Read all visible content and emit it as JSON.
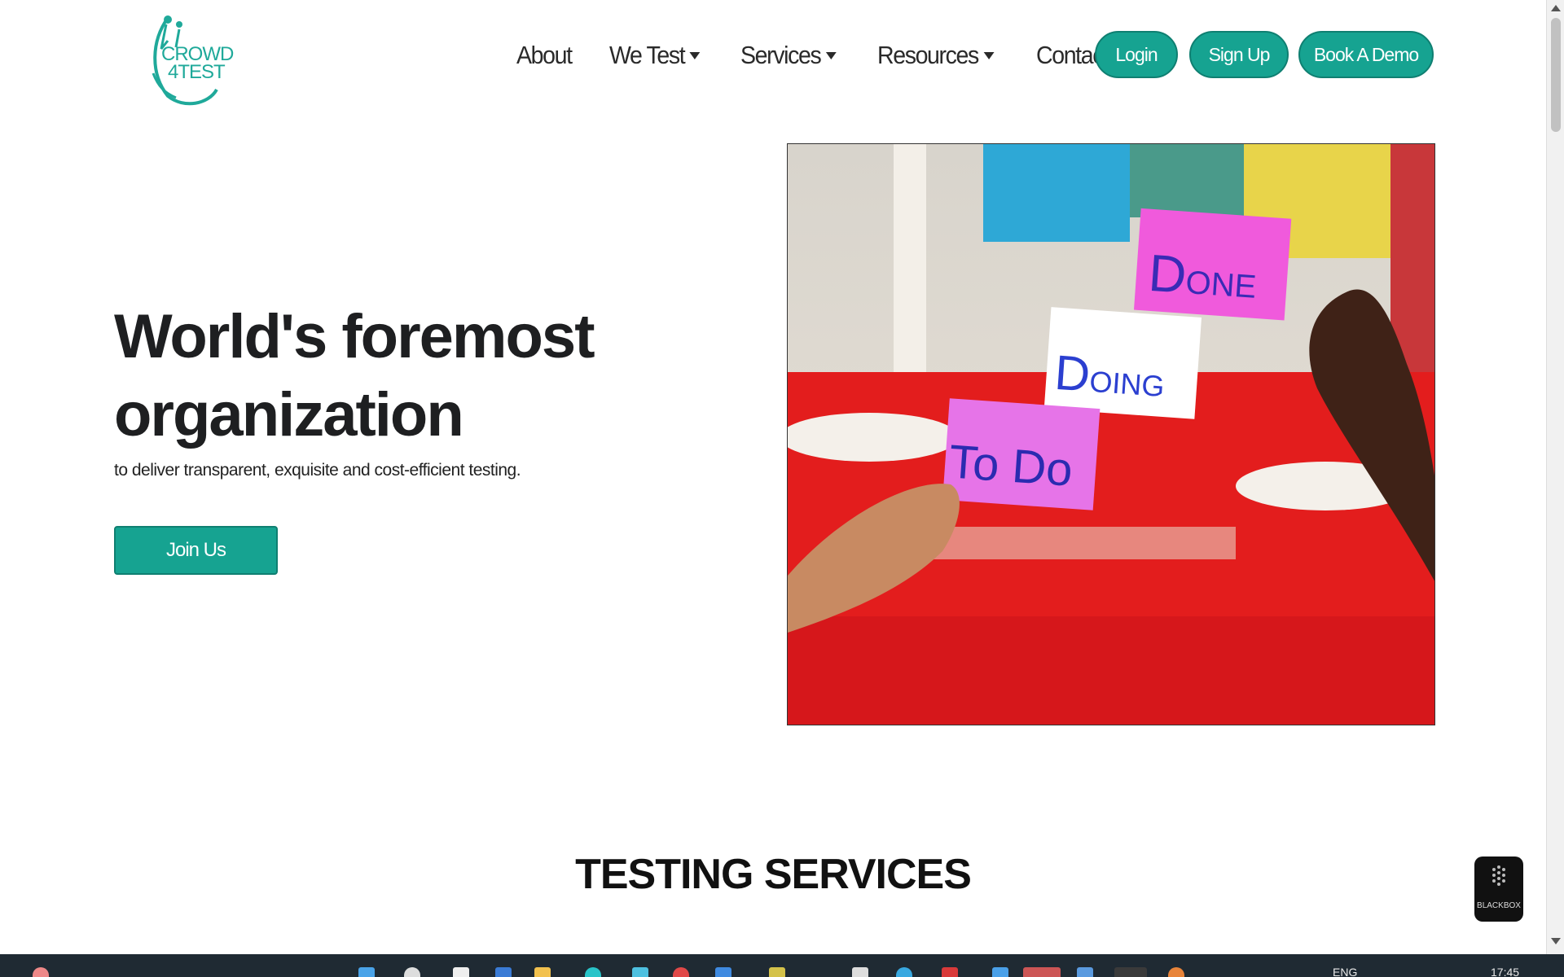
{
  "logo": {
    "line1": "CROWD",
    "line2": "4TEST"
  },
  "nav": {
    "items": [
      {
        "label": "About",
        "has_dropdown": false
      },
      {
        "label": "We Test",
        "has_dropdown": true
      },
      {
        "label": "Services",
        "has_dropdown": true
      },
      {
        "label": "Resources",
        "has_dropdown": true
      },
      {
        "label": "Contact",
        "has_dropdown": false
      }
    ]
  },
  "auth": {
    "login": "Login",
    "signup": "Sign Up",
    "demo": "Book A Demo"
  },
  "hero": {
    "title_line1": "World's foremost",
    "title_line2": "organization",
    "subtitle": "to deliver transparent, exquisite and cost-efficient testing.",
    "cta": "Join Us",
    "image_notes": [
      "Done",
      "Doing",
      "To Do"
    ]
  },
  "section": {
    "title": "TESTING SERVICES"
  },
  "widget": {
    "label": "BLACKBOX"
  },
  "taskbar": {
    "lang": "ENG",
    "time": "17:45"
  },
  "colors": {
    "accent": "#16a391",
    "text": "#1e1f21"
  }
}
